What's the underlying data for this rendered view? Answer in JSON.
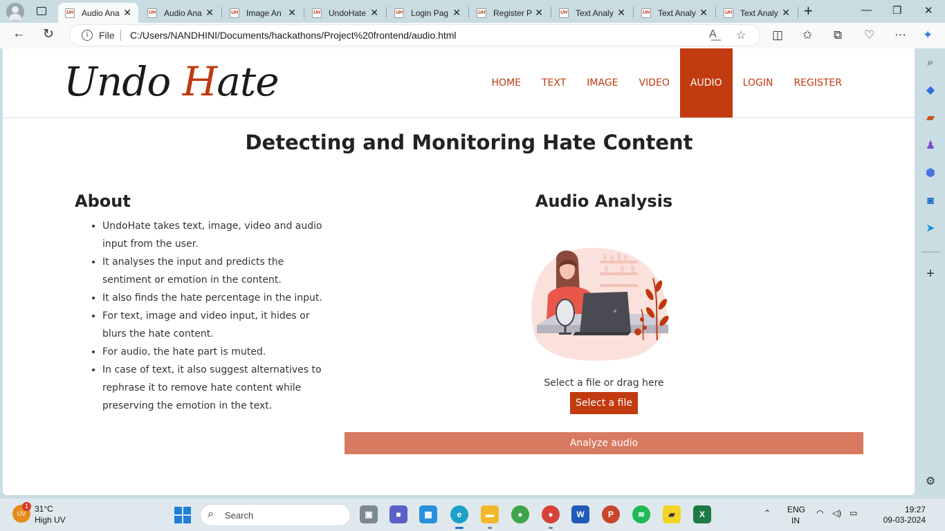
{
  "browser": {
    "tabs": [
      {
        "label": "Audio Ana",
        "active": true
      },
      {
        "label": "Audio Ana",
        "active": false
      },
      {
        "label": "Image An",
        "active": false
      },
      {
        "label": "UndoHate",
        "active": false
      },
      {
        "label": "Login Pag",
        "active": false
      },
      {
        "label": "Register P",
        "active": false
      },
      {
        "label": "Text Analy",
        "active": false
      },
      {
        "label": "Text Analy",
        "active": false
      },
      {
        "label": "Text Analy",
        "active": false
      }
    ],
    "favicon_text": "UH",
    "file_label": "File",
    "url": "C:/Users/NANDHINI/Documents/hackathons/Project%20frontend/audio.html"
  },
  "page": {
    "logo_part1": "Undo ",
    "logo_accent": "H",
    "logo_part2": "ate",
    "nav": {
      "home": "HOME",
      "text": "TEXT",
      "image": "IMAGE",
      "video": "VIDEO",
      "audio": "AUDIO",
      "login": "LOGIN",
      "register": "REGISTER"
    },
    "title": "Detecting and Monitoring Hate Content",
    "about": {
      "heading": "About",
      "items": [
        "UndoHate takes text, image, video and audio input from the user.",
        "It analyses the input and predicts the sentiment or emotion in the content.",
        "It also finds the hate percentage in the input.",
        "For text, image and video input, it hides or blurs the hate content.",
        "For audio, the hate part is muted.",
        "In case of text, it also suggest alternatives to rephrase it to remove hate content while preserving the emotion in the text."
      ]
    },
    "audio": {
      "heading": "Audio Analysis",
      "select_prompt": "Select a file or drag here",
      "select_button": "Select a file",
      "analyze_button": "Analyze audio"
    }
  },
  "taskbar": {
    "weather_temp": "31°C",
    "weather_desc": "High UV",
    "weather_icon": "UV",
    "weather_badge": "1",
    "search_placeholder": "Search",
    "lang_line1": "ENG",
    "lang_line2": "IN",
    "time": "19:27",
    "date": "09-03-2024"
  },
  "colors": {
    "brand": "#c23a10",
    "analyze": "#d87a60"
  }
}
